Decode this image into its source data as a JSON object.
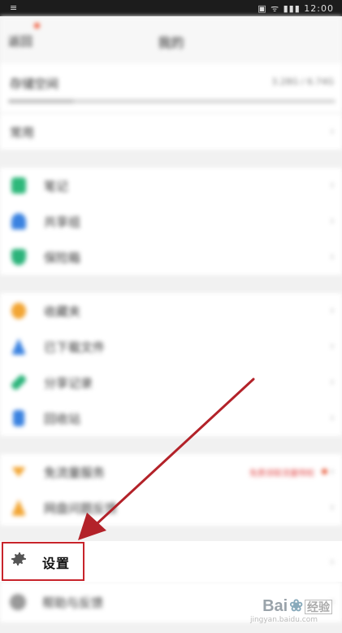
{
  "status_bar": {
    "left": "≡",
    "right": "▣ ᯤ ▮▮▮ 12:00"
  },
  "header": {
    "back": "返回",
    "title": "我的"
  },
  "storage": {
    "label": "存储空间",
    "value": "3.28G / 6.74G",
    "used_fraction": 0.2
  },
  "menu_vip": {
    "label": "常用"
  },
  "group1": [
    {
      "label": "笔记",
      "icon": "note-icon",
      "color": "#2db87a"
    },
    {
      "label": "共享组",
      "icon": "share-group-icon",
      "color": "#3a82e0"
    },
    {
      "label": "保险箱",
      "icon": "safe-icon",
      "color": "#2bb37a"
    }
  ],
  "group2": [
    {
      "label": "收藏夹",
      "icon": "star-icon",
      "color": "#f2a533"
    },
    {
      "label": "已下载文件",
      "icon": "download-icon",
      "color": "#3a82e0"
    },
    {
      "label": "分享记录",
      "icon": "link-icon",
      "color": "#2bb37a"
    },
    {
      "label": "回收站",
      "icon": "trash-icon",
      "color": "#3a82e0"
    }
  ],
  "group3": [
    {
      "label": "免流量服务",
      "icon": "traffic-icon",
      "color": "#f2a533",
      "note": "免费领取流量特权"
    },
    {
      "label": "网盘问题反馈",
      "icon": "warning-icon",
      "color": "#f2a533"
    }
  ],
  "settings": {
    "label": "设置",
    "icon": "gear-icon"
  },
  "help": {
    "label": "帮助与反馈"
  },
  "watermark": {
    "brand": "Bai",
    "brand2": "经验",
    "url": "jingyan.baidu.com"
  },
  "colors": {
    "highlight": "#c8242b",
    "arrow": "#b32229"
  }
}
